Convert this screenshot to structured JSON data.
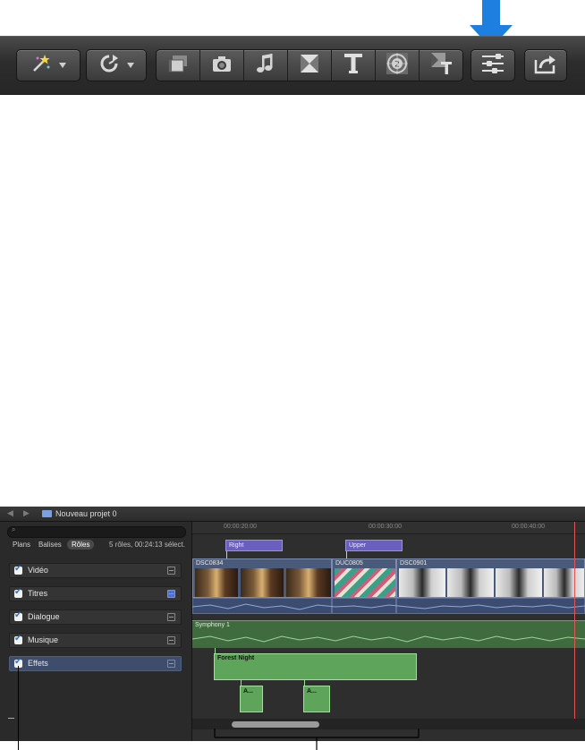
{
  "toolbar": {
    "left_buttons": [
      {
        "icon": "magic-wand-icon"
      },
      {
        "icon": "retime-icon"
      }
    ],
    "browser_buttons": [
      {
        "icon": "clip-browser-icon"
      },
      {
        "icon": "photo-browser-icon"
      },
      {
        "icon": "music-browser-icon"
      },
      {
        "icon": "transitions-browser-icon"
      },
      {
        "icon": "titles-browser-icon"
      },
      {
        "icon": "generators-browser-icon"
      },
      {
        "icon": "themes-browser-icon"
      }
    ],
    "inspector_icon": "inspector-icon",
    "share_icon": "share-icon"
  },
  "window": {
    "project_title": "Nouveau projet 0"
  },
  "index": {
    "tabs": [
      "Plans",
      "Balises",
      "Rôles"
    ],
    "selected_tab": "Rôles",
    "summary": "5 rôles, 00:24:13 sélect.",
    "roles": [
      {
        "label": "Vidéo",
        "checked": true,
        "selected": false
      },
      {
        "label": "Titres",
        "checked": true,
        "selected": false
      },
      {
        "label": "Dialogue",
        "checked": true,
        "selected": false
      },
      {
        "label": "Musique",
        "checked": true,
        "selected": false
      },
      {
        "label": "Effets",
        "checked": true,
        "selected": true
      }
    ]
  },
  "timeline": {
    "ruler": [
      "00:00:20:00",
      "00:00:30:00",
      "00:00:40:00"
    ],
    "titles": [
      "Right",
      "Upper"
    ],
    "video_clips": [
      "DSC0834",
      "DUC0805",
      "DSC0901"
    ],
    "music_clip": "Symphony 1",
    "effect_clip": "Forest Night",
    "small_clips": [
      "A...",
      "A..."
    ]
  },
  "colors": {
    "arrow": "#1d7fe0",
    "title_clip": "#6a5fbf",
    "video_clip": "#4a5a7a",
    "music_clip": "#3f6b3f",
    "effect_clip": "#5fa45b",
    "playhead": "#e25555"
  }
}
